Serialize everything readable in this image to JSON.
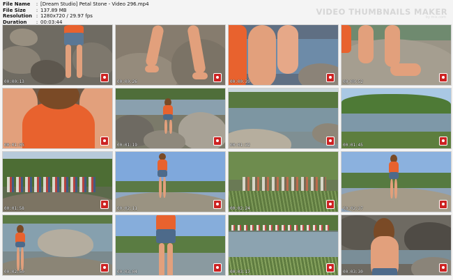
{
  "header": {
    "rows": [
      {
        "key": "File Name",
        "value": "[Dream Studio] Petal Stone - Video 296.mp4"
      },
      {
        "key": "File Size",
        "value": "137.89 MB"
      },
      {
        "key": "Resolution",
        "value": "1280x720 / 29.97 fps"
      },
      {
        "key": "Duration",
        "value": "00:03:44"
      }
    ],
    "brand": "VIDEO THUMBNAILS MAKER",
    "brand_sub": "by mix.com",
    "separator": ":"
  },
  "thumbnails": [
    {
      "time": "00:00:13",
      "scene": "girl-rocks"
    },
    {
      "time": "00:00:26",
      "scene": "legs-rock"
    },
    {
      "time": "00:00:39",
      "scene": "legs-closeup"
    },
    {
      "time": "00:00:52",
      "scene": "feet-rock"
    },
    {
      "time": "00:01:05",
      "scene": "torso-shirt"
    },
    {
      "time": "00:01:19",
      "scene": "river-rocks-girl"
    },
    {
      "time": "00:01:32",
      "scene": "river-landscape"
    },
    {
      "time": "00:01:45",
      "scene": "river-trees-sky"
    },
    {
      "time": "00:01:58",
      "scene": "crowd-trees"
    },
    {
      "time": "00:02:11",
      "scene": "girl-standing-sky"
    },
    {
      "time": "00:02:24",
      "scene": "crowd-reeds"
    },
    {
      "time": "00:02:37",
      "scene": "girl-rock-sky"
    },
    {
      "time": "00:02:50",
      "scene": "girl-river-rocks"
    },
    {
      "time": "00:03:04",
      "scene": "girl-closeup-sky"
    },
    {
      "time": "00:03:17",
      "scene": "rapids-crowd"
    },
    {
      "time": "00:03:30",
      "scene": "back-rocks"
    }
  ]
}
